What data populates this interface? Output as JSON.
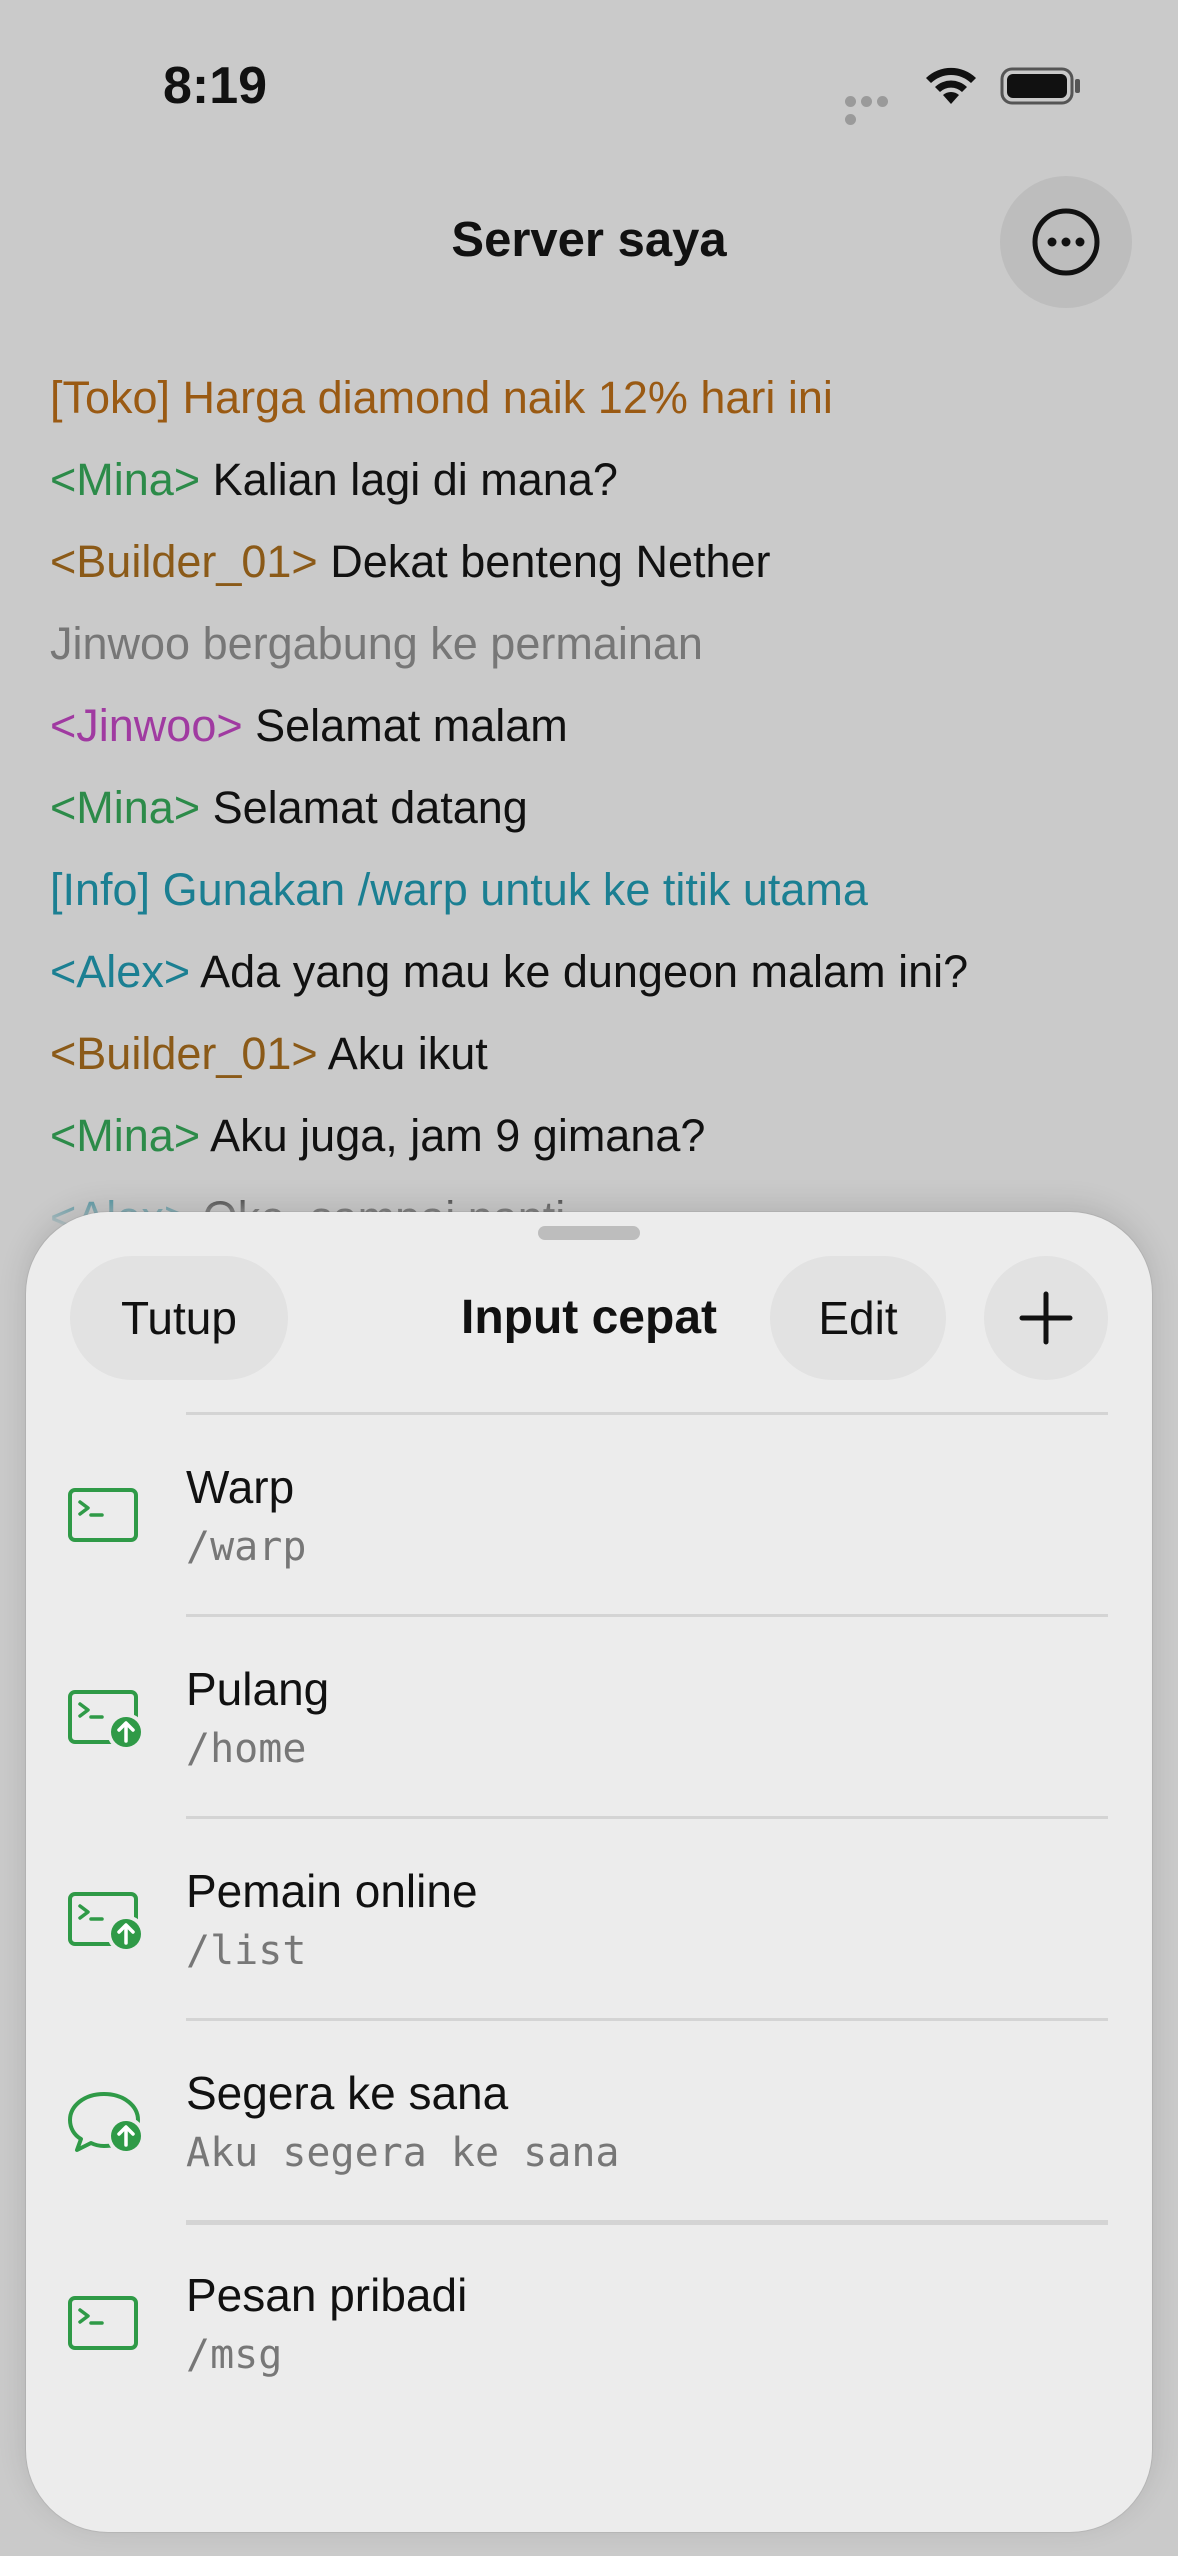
{
  "status_bar": {
    "time": "8:19"
  },
  "header": {
    "title": "Server saya",
    "more_icon": "ellipsis-circle-icon"
  },
  "chat": [
    {
      "parts": [
        {
          "text": "[Toko] Harga diamond naik 12% hari ini",
          "style": "c-shop"
        }
      ]
    },
    {
      "parts": [
        {
          "text": "<Mina>",
          "style": "c-green"
        },
        {
          "text": " Kalian lagi di mana?",
          "style": "c-text"
        }
      ]
    },
    {
      "parts": [
        {
          "text": "<Builder_01>",
          "style": "c-brown"
        },
        {
          "text": " Dekat benteng Nether",
          "style": "c-text"
        }
      ]
    },
    {
      "parts": [
        {
          "text": "Jinwoo bergabung ke permainan",
          "style": "c-gray"
        }
      ]
    },
    {
      "parts": [
        {
          "text": "<Jinwoo>",
          "style": "c-purple"
        },
        {
          "text": " Selamat malam",
          "style": "c-text"
        }
      ]
    },
    {
      "parts": [
        {
          "text": "<Mina>",
          "style": "c-green"
        },
        {
          "text": " Selamat datang",
          "style": "c-text"
        }
      ]
    },
    {
      "parts": [
        {
          "text": "[Info] Gunakan /warp untuk ke titik utama",
          "style": "c-teal"
        }
      ]
    },
    {
      "parts": [
        {
          "text": "<Alex>",
          "style": "c-teal"
        },
        {
          "text": " Ada yang mau ke dungeon malam ini?",
          "style": "c-text"
        }
      ]
    },
    {
      "parts": [
        {
          "text": "<Builder_01>",
          "style": "c-brown"
        },
        {
          "text": " Aku ikut",
          "style": "c-text"
        }
      ]
    },
    {
      "parts": [
        {
          "text": "<Mina>",
          "style": "c-green"
        },
        {
          "text": " Aku juga, jam 9 gimana?",
          "style": "c-text"
        }
      ]
    },
    {
      "parts": [
        {
          "text": "<Alex>",
          "style": "c-teal"
        },
        {
          "text": " Oke, sampai nanti",
          "style": "c-text"
        }
      ]
    }
  ],
  "sheet": {
    "title": "Input cepat",
    "close_label": "Tutup",
    "edit_label": "Edit",
    "add_icon": "plus-icon",
    "items": [
      {
        "label": "Warp",
        "command": "/warp",
        "icon": "terminal-icon"
      },
      {
        "label": "Pulang",
        "command": "/home",
        "icon": "terminal-send-icon"
      },
      {
        "label": "Pemain online",
        "command": "/list",
        "icon": "terminal-send-icon"
      },
      {
        "label": "Segera ke sana",
        "command": "Aku segera ke sana",
        "icon": "chat-bubble-send-icon"
      },
      {
        "label": "Pesan pribadi",
        "command": "/msg",
        "icon": "terminal-icon"
      }
    ]
  },
  "colors": {
    "accent_green": "#2f9a47",
    "background": "#cacaca",
    "sheet_background": "#ececec"
  }
}
